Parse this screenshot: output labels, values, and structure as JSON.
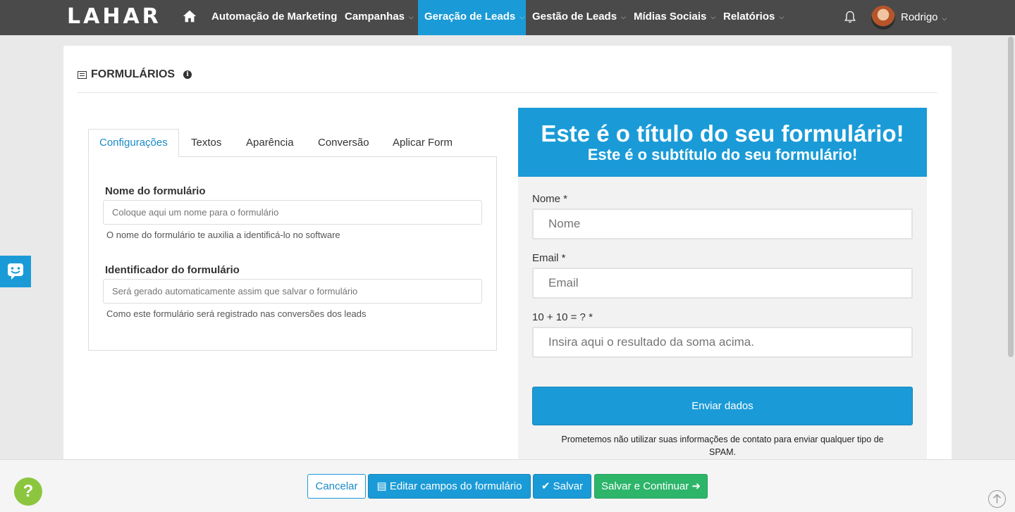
{
  "navbar": {
    "logo": "LAHAR",
    "items": [
      {
        "label": "Automação de Marketing",
        "caret": false
      },
      {
        "label": "Campanhas",
        "caret": true
      },
      {
        "label": "Geração de Leads",
        "caret": true
      },
      {
        "label": "Gestão de Leads",
        "caret": true
      },
      {
        "label": "Mídias Sociais",
        "caret": true
      },
      {
        "label": "Relatórios",
        "caret": true
      }
    ],
    "active_item": "Geração de Leads",
    "user_name": "Rodrigo",
    "icons": {
      "home": "home-icon",
      "notifications": "bell-icon",
      "caret": "chevron-down-icon"
    }
  },
  "page": {
    "title": "FORMULÁRIOS"
  },
  "tabs": [
    {
      "label": "Configurações"
    },
    {
      "label": "Textos"
    },
    {
      "label": "Aparência"
    },
    {
      "label": "Conversão"
    },
    {
      "label": "Aplicar Form"
    }
  ],
  "active_tab": "Configurações",
  "form": {
    "name_label": "Nome do formulário",
    "name_placeholder": "Coloque aqui um nome para o formulário",
    "name_help": "O nome do formulário te auxilia a identificá-lo no software",
    "id_label": "Identificador do formulário",
    "id_placeholder": "Será gerado automaticamente assim que salvar o formulário",
    "id_help": "Como este formulário será registrado nas conversões dos leads"
  },
  "preview": {
    "title": "Este é o título do seu formulário!",
    "subtitle": "Este é o subtítulo do seu formulário!",
    "fields": [
      {
        "label": "Nome *",
        "placeholder": "Nome"
      },
      {
        "label": "Email *",
        "placeholder": "Email"
      },
      {
        "label": "10 + 10 = ? *",
        "placeholder": "Insira aqui o resultado da soma acima."
      }
    ],
    "submit_label": "Enviar dados",
    "note": "Prometemos não utilizar suas informações de contato para enviar qualquer tipo de SPAM."
  },
  "footer": {
    "cancel": "Cancelar",
    "edit_fields": "Editar campos do formulário",
    "save": "Salvar",
    "save_continue": "Salvar e Continuar"
  },
  "widgets": {
    "help": "?"
  },
  "colors": {
    "navbar_bg": "#4a4a4a",
    "accent": "#1a9bd7",
    "success": "#2db56a",
    "help_green": "#8cc63f"
  }
}
